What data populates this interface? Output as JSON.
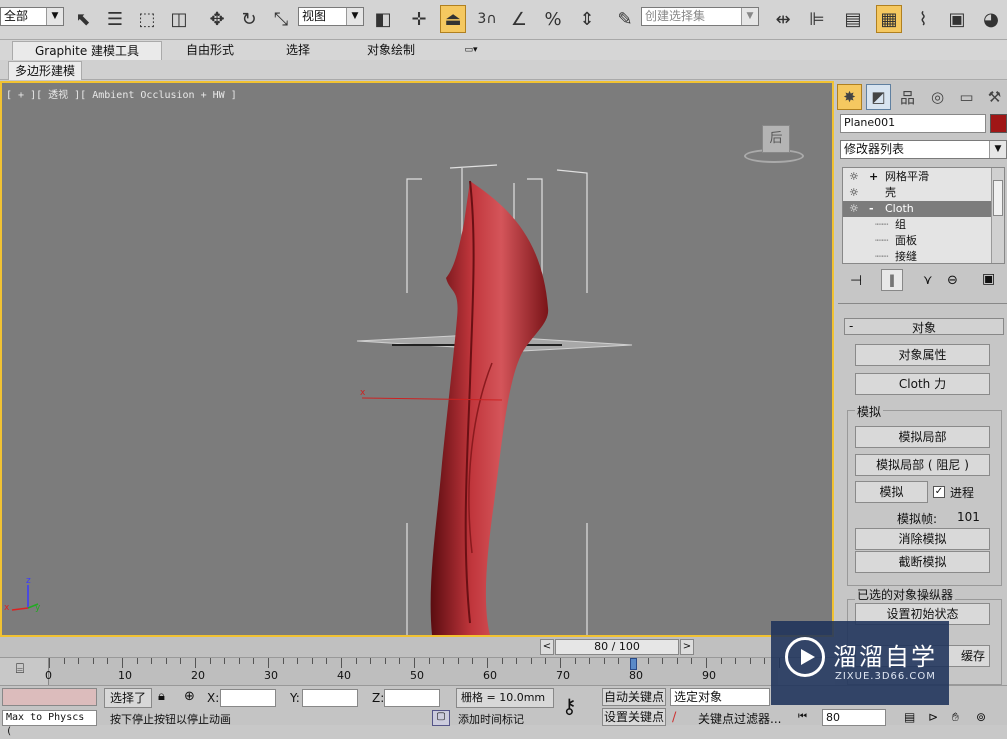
{
  "toolbar": {
    "selection_filter": "全部",
    "ref_coord": "视图",
    "snap_label": "3",
    "named_selection_placeholder": "创建选择集",
    "icons": [
      "select-object-icon",
      "select-by-name-icon",
      "rect-region-icon",
      "window-crossing-icon",
      "move-icon",
      "rotate-icon",
      "scale-icon",
      "pivot-icon",
      "select-manipulate-icon",
      "keyboard-shortcut-icon",
      "snaps-toggle-icon",
      "angle-snap-icon",
      "percent-snap-icon",
      "spinner-snap-icon",
      "edit-named-sets-icon",
      "mirror-icon",
      "align-icon",
      "layer-manager-icon",
      "graphite-toggle-icon",
      "curve-editor-icon",
      "schematic-view-icon",
      "material-editor-icon"
    ]
  },
  "ribbon": {
    "tabs": [
      "Graphite 建模工具",
      "自由形式",
      "选择",
      "对象绘制"
    ],
    "sub_tab": "多边形建模"
  },
  "viewport": {
    "label": "[ + ][ 透视 ][ Ambient Occlusion + HW ]",
    "viewcube_face": "后",
    "axis_labels": {
      "x": "x",
      "y": "y",
      "z": "z"
    },
    "object_color": "#b0282c",
    "border_color": "#f1c232"
  },
  "command_panel": {
    "tab_icons": [
      "create-icon",
      "modify-icon",
      "hierarchy-icon",
      "motion-icon",
      "display-icon",
      "utilities-icon"
    ],
    "object_name": "Plane001",
    "object_color": "#a01616",
    "modifier_list": "修改器列表",
    "stack": [
      {
        "label": "网格平滑",
        "level": 0,
        "expand": "+",
        "selected": false
      },
      {
        "label": "壳",
        "level": 0,
        "expand": "",
        "selected": false
      },
      {
        "label": "Cloth",
        "level": 0,
        "expand": "-",
        "selected": true
      },
      {
        "label": "组",
        "level": 1,
        "expand": "",
        "selected": false
      },
      {
        "label": "面板",
        "level": 1,
        "expand": "",
        "selected": false
      },
      {
        "label": "接缝",
        "level": 1,
        "expand": "",
        "selected": false
      }
    ],
    "rollout": {
      "toggle": "-",
      "title": "对象",
      "object_properties": "对象属性",
      "cloth_forces": "Cloth 力",
      "sim_group": "模拟",
      "sim_local": "模拟局部",
      "sim_local_damped": "模拟局部 ( 阻尼 )",
      "simulate": "模拟",
      "progress_label": "进程",
      "progress_checked": true,
      "sim_frames_label": "模拟帧:",
      "sim_frames_value": "101",
      "erase_sim": "消除模拟",
      "truncate_sim": "截断模拟",
      "manipulator_group": "已选的对象操纵器",
      "set_initial_state": "设置初始状态",
      "cache_partial": "缓存"
    }
  },
  "timeline": {
    "frame_display": "80 / 100",
    "current_frame": 80,
    "total_frames": 100,
    "ticks": [
      "0",
      "10",
      "20",
      "30",
      "40",
      "50",
      "60",
      "70",
      "80",
      "90"
    ]
  },
  "status": {
    "maxscript_text": "Max to Physcs (",
    "selected_text": "选择了",
    "x_label": "X:",
    "y_label": "Y:",
    "z_label": "Z:",
    "grid_text": "栅格 = 10.0mm",
    "prompt_text": "按下停止按钮以停止动画",
    "add_time_tag": "添加时间标记",
    "auto_key": "自动关键点",
    "set_key": "设置关键点",
    "selection_set": "选定对象",
    "key_filters": "关键点过滤器...",
    "frame_field": "80"
  },
  "watermark": {
    "title": "溜溜自学",
    "url": "ZIXUE.3D66.COM"
  }
}
